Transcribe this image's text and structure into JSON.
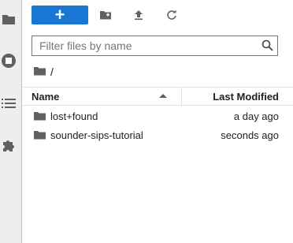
{
  "toolbar": {
    "new_label": "+",
    "accent": "#1976d2"
  },
  "search": {
    "placeholder": "Filter files by name",
    "value": ""
  },
  "breadcrumb": {
    "path": "/"
  },
  "header": {
    "name": "Name",
    "modified": "Last Modified",
    "sort": "name-ascending"
  },
  "files": [
    {
      "name": "lost+found",
      "modified": "a day ago",
      "type": "folder"
    },
    {
      "name": "sounder-sips-tutorial",
      "modified": "seconds ago",
      "type": "folder"
    }
  ],
  "sidebar": {
    "icons": [
      "folder-icon",
      "running-icon",
      "list-icon",
      "extension-icon"
    ]
  }
}
